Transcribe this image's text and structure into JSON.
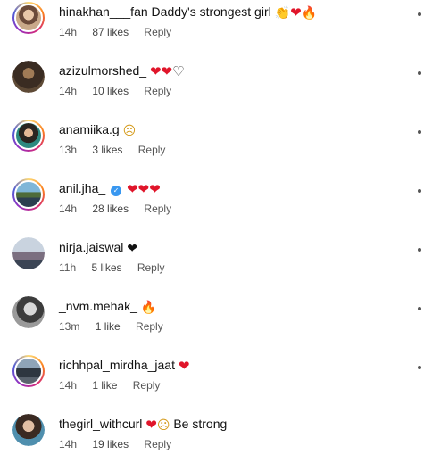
{
  "comments": [
    {
      "username": "hinakhan___fan",
      "text": "Daddy's strongest girl",
      "time": "14h",
      "likes": "87 likes",
      "reply": "Reply",
      "emojis": [
        "clapping-hands",
        "red-heart",
        "fire"
      ]
    },
    {
      "username": "azizulmorshed_",
      "text": "",
      "time": "14h",
      "likes": "10 likes",
      "reply": "Reply",
      "emojis": [
        "red-heart",
        "red-heart",
        "white-heart"
      ]
    },
    {
      "username": "anamiika.g",
      "text": "",
      "time": "13h",
      "likes": "3 likes",
      "reply": "Reply",
      "emojis": [
        "sad-face"
      ]
    },
    {
      "username": "anil.jha_",
      "text": "",
      "time": "14h",
      "likes": "28 likes",
      "reply": "Reply",
      "verified": true,
      "emojis": [
        "red-heart",
        "red-heart",
        "red-heart"
      ]
    },
    {
      "username": "nirja.jaiswal",
      "text": "",
      "time": "11h",
      "likes": "5 likes",
      "reply": "Reply",
      "emojis": [
        "black-heart"
      ]
    },
    {
      "username": "_nvm.mehak_",
      "text": "",
      "time": "13m",
      "likes": "1 like",
      "reply": "Reply",
      "emojis": [
        "fire"
      ]
    },
    {
      "username": "richhpal_mirdha_jaat",
      "text": "",
      "time": "14h",
      "likes": "1 like",
      "reply": "Reply",
      "emojis": [
        "red-heart"
      ]
    },
    {
      "username": "thegirl_withcurl",
      "text": "Be strong",
      "time": "14h",
      "likes": "19 likes",
      "reply": "Reply",
      "emojis": [
        "red-heart",
        "sad-face"
      ]
    }
  ],
  "colors": {
    "story_ring": [
      "#feda75",
      "#fa7e1e",
      "#d62976",
      "#962fbf",
      "#4f5bd5"
    ],
    "heart_red": "#e0152a",
    "verified_blue": "#3897f0"
  }
}
